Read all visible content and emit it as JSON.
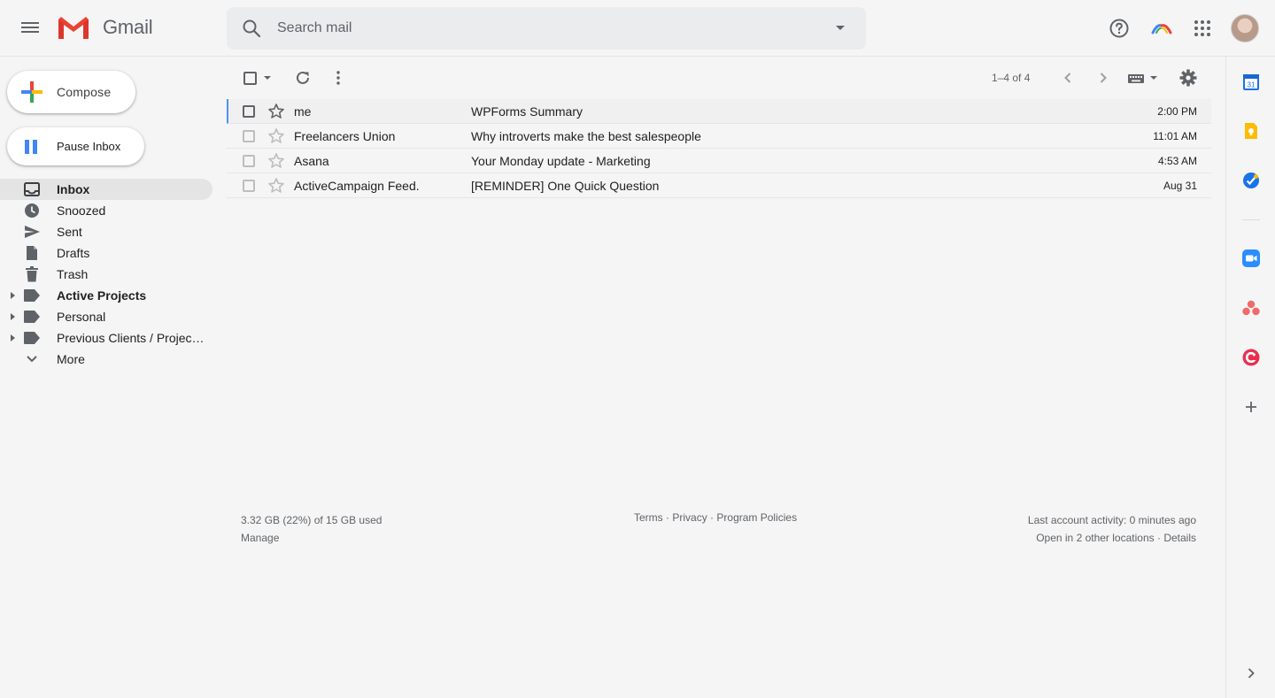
{
  "app": {
    "name": "Gmail"
  },
  "search": {
    "placeholder": "Search mail"
  },
  "sidebar": {
    "compose_label": "Compose",
    "pause_label": "Pause Inbox",
    "items": [
      {
        "label": "Inbox",
        "icon": "inbox-icon",
        "active": true
      },
      {
        "label": "Snoozed",
        "icon": "clock-icon"
      },
      {
        "label": "Sent",
        "icon": "send-icon"
      },
      {
        "label": "Drafts",
        "icon": "draft-icon"
      },
      {
        "label": "Trash",
        "icon": "trash-icon"
      },
      {
        "label": "Active Projects",
        "icon": "label-icon",
        "bold": true,
        "expandable": true
      },
      {
        "label": "Personal",
        "icon": "label-icon",
        "expandable": true
      },
      {
        "label": "Previous Clients / Projec…",
        "icon": "label-icon",
        "expandable": true
      },
      {
        "label": "More",
        "icon": "chevron-down-icon"
      }
    ]
  },
  "toolbar": {
    "pager": "1–4 of 4"
  },
  "emails": [
    {
      "sender": "me",
      "subject": "WPForms Summary",
      "time": "2:00 PM"
    },
    {
      "sender": "Freelancers Union",
      "subject": "Why introverts make the best salespeople",
      "time": "11:01 AM"
    },
    {
      "sender": "Asana",
      "subject": "Your Monday update - Marketing",
      "time": "4:53 AM"
    },
    {
      "sender": "ActiveCampaign Feed.",
      "subject": "[REMINDER] One Quick Question",
      "time": "Aug 31"
    }
  ],
  "footer": {
    "storage": "3.32 GB (22%) of 15 GB used",
    "manage": "Manage",
    "terms": "Terms",
    "privacy": "Privacy",
    "policies": "Program Policies",
    "separator": "·",
    "activity": "Last account activity: 0 minutes ago",
    "other_locations": "Open in 2 other locations",
    "details": "Details"
  },
  "right_panel": {
    "calendar_day": "31",
    "apps": [
      "calendar-icon",
      "keep-icon",
      "tasks-icon",
      "zoom-icon",
      "asana-icon",
      "clockify-icon",
      "add-addon-icon"
    ]
  },
  "colors": {
    "accent": "#4285f4",
    "brand_red": "#ea4335",
    "green": "#34a853",
    "yellow": "#fbbc04"
  }
}
